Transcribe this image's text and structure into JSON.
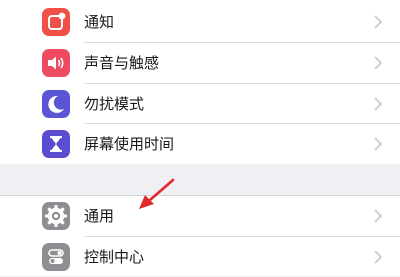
{
  "settings": {
    "group1": [
      {
        "label": "通知",
        "icon": "notifications-icon",
        "color": "#f05047"
      },
      {
        "label": "声音与触感",
        "icon": "sounds-icon",
        "color": "#ee4a64"
      },
      {
        "label": "勿扰模式",
        "icon": "moon-icon",
        "color": "#5a55d6"
      },
      {
        "label": "屏幕使用时间",
        "icon": "hourglass-icon",
        "color": "#5a4dcf"
      }
    ],
    "group2": [
      {
        "label": "通用",
        "icon": "gear-icon",
        "color": "#8e8e93"
      },
      {
        "label": "控制中心",
        "icon": "toggles-icon",
        "color": "#8e8e93"
      }
    ]
  },
  "annotation": {
    "arrow_color": "#e02a2a"
  },
  "chevron_color": "#c7c7cc"
}
